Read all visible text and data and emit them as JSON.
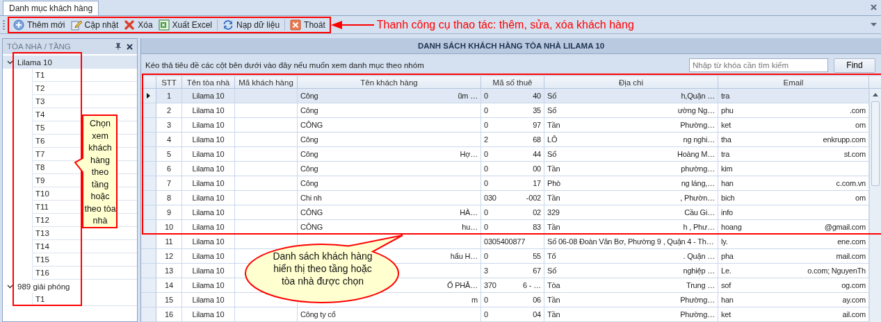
{
  "tabs": [
    {
      "label": "Danh mục khách hàng",
      "selected": true
    }
  ],
  "toolbar": {
    "buttons": [
      {
        "label": "Thêm mới",
        "kind": "add",
        "separator_before": false
      },
      {
        "label": "Cập nhật",
        "kind": "edit",
        "separator_before": false
      },
      {
        "label": "Xóa",
        "kind": "delete",
        "separator_before": false
      },
      {
        "label": "Xuất Excel",
        "kind": "excel",
        "separator_before": false
      },
      {
        "label": "Nạp dữ liệu",
        "kind": "refresh",
        "separator_before": true
      },
      {
        "label": "Thoát",
        "kind": "exit",
        "separator_before": true
      }
    ]
  },
  "tree": {
    "title": "TÒA NHÀ / TẦNG",
    "nodes": [
      {
        "label": "Lilama 10",
        "expanded": true,
        "selected": true,
        "children": [
          {
            "label": "T1"
          },
          {
            "label": "T2"
          },
          {
            "label": "T3"
          },
          {
            "label": "T4"
          },
          {
            "label": "T5"
          },
          {
            "label": "T6"
          },
          {
            "label": "T7"
          },
          {
            "label": "T8"
          },
          {
            "label": "T9"
          },
          {
            "label": "T10"
          },
          {
            "label": "T11"
          },
          {
            "label": "T12"
          },
          {
            "label": "T13"
          },
          {
            "label": "T14"
          },
          {
            "label": "T15"
          },
          {
            "label": "T16"
          }
        ]
      },
      {
        "label": "989 giải phóng",
        "expanded": true,
        "selected": false,
        "children": [
          {
            "label": "T1"
          }
        ]
      }
    ]
  },
  "grid": {
    "title": "DANH SÁCH KHÁCH HÀNG TÒA NHÀ LILAMA 10",
    "group_hint": "Kéo thả tiêu đề các cột bên dưới vào đây nếu muốn xem danh mục theo nhóm",
    "search": {
      "placeholder": "Nhập từ khóa cần tìm kiếm"
    },
    "find_button": "Find",
    "columns": [
      {
        "label": "STT"
      },
      {
        "label": "Tên tòa nhà"
      },
      {
        "label": "Mã khách hàng"
      },
      {
        "label": "Tên khách hàng"
      },
      {
        "label": "Mã số thuê"
      },
      {
        "label": "Địa chi"
      },
      {
        "label": "Email"
      }
    ],
    "rows": [
      {
        "selected": true,
        "stt": "1",
        "building": "Lilama 10",
        "name": {
          "start": "Công",
          "end": "ũm …"
        },
        "tax": {
          "start": "0",
          "end": "40"
        },
        "address": {
          "start": "Số",
          "end": "h,Quận …"
        },
        "email": {
          "start": "tra"
        }
      },
      {
        "selected": false,
        "stt": "2",
        "building": "Lilama 10",
        "name": {
          "start": "Công"
        },
        "tax": {
          "start": "0",
          "end": "35"
        },
        "address": {
          "start": "Số",
          "end": "ường Ng…"
        },
        "email": {
          "start": "phu",
          "end": ".com"
        }
      },
      {
        "selected": false,
        "stt": "3",
        "building": "Lilama 10",
        "name": {
          "start": "CÔNG"
        },
        "tax": {
          "start": "0",
          "end": "97"
        },
        "address": {
          "start": "Tần",
          "end": "Phường…"
        },
        "email": {
          "start": "ket",
          "end": "om"
        }
      },
      {
        "selected": false,
        "stt": "4",
        "building": "Lilama 10",
        "name": {
          "start": "Công"
        },
        "tax": {
          "start": "2",
          "end": "68"
        },
        "address": {
          "start": "LÔ",
          "end": "ng nghi…"
        },
        "email": {
          "start": "tha",
          "end": "enkrupp.com"
        }
      },
      {
        "selected": false,
        "stt": "5",
        "building": "Lilama 10",
        "name": {
          "start": "Công",
          "end": "Hợ…"
        },
        "tax": {
          "start": "0",
          "end": "44"
        },
        "address": {
          "start": "Số",
          "end": "Hoàng M…"
        },
        "email": {
          "start": "tra",
          "end": "st.com"
        }
      },
      {
        "selected": false,
        "stt": "6",
        "building": "Lilama 10",
        "name": {
          "start": "Công"
        },
        "tax": {
          "start": "0",
          "end": "00"
        },
        "address": {
          "start": "Tần",
          "end": "phường…"
        },
        "email": {
          "start": "kim"
        }
      },
      {
        "selected": false,
        "stt": "7",
        "building": "Lilama 10",
        "name": {
          "start": "Công"
        },
        "tax": {
          "start": "0",
          "end": "17"
        },
        "address": {
          "start": "Phò",
          "end": "ng láng,…"
        },
        "email": {
          "start": "han",
          "end": "c.com.vn"
        }
      },
      {
        "selected": false,
        "stt": "8",
        "building": "Lilama 10",
        "name": {
          "start": "Chi nh"
        },
        "tax": {
          "start": "030",
          "end": "-002"
        },
        "address": {
          "start": "Tần",
          "end": ", Phườn…"
        },
        "email": {
          "start": "bich",
          "end": "om"
        }
      },
      {
        "selected": false,
        "stt": "9",
        "building": "Lilama 10",
        "name": {
          "start": "CÔNG",
          "end": "HÀ…"
        },
        "tax": {
          "start": "0",
          "end": "02"
        },
        "address": {
          "start": "329",
          "end": "Cầu Gi…"
        },
        "email": {
          "start": "info"
        }
      },
      {
        "selected": false,
        "stt": "10",
        "building": "Lilama 10",
        "name": {
          "start": "CÔNG",
          "end": "hu…"
        },
        "tax": {
          "start": "0",
          "end": "83"
        },
        "address": {
          "start": "Tần",
          "end": "h , Phư…"
        },
        "email": {
          "start": "hoang",
          "end": "@gmail.com"
        }
      },
      {
        "selected": false,
        "stt": "11",
        "building": "Lilama 10",
        "tax": {
          "start": "0305400877"
        },
        "address": {
          "start": "Số 06-08 Đoàn Văn Bơ, Phường 9 , Quận 4 - Th…"
        },
        "email": {
          "start": "ly.",
          "end": "ene.com"
        }
      },
      {
        "selected": false,
        "stt": "12",
        "building": "Lilama 10",
        "name": {
          "end": "hẩu H…"
        },
        "tax": {
          "start": "0",
          "end": "55"
        },
        "address": {
          "start": "Tổ",
          "end": ". Quận …"
        },
        "email": {
          "start": "pha",
          "end": "mail.com"
        }
      },
      {
        "selected": false,
        "stt": "13",
        "building": "Lilama 10",
        "tax": {
          "start": "3",
          "end": "67"
        },
        "address": {
          "start": "Số",
          "end": "nghiệp …"
        },
        "email": {
          "start": "Le.",
          "end": "o.com; NguyenTh"
        }
      },
      {
        "selected": false,
        "stt": "14",
        "building": "Lilama 10",
        "name": {
          "end": "Ố PHẪ…"
        },
        "tax": {
          "start": "370",
          "end": "6 - …"
        },
        "address": {
          "start": "Tòa",
          "end": "Trung …"
        },
        "email": {
          "start": "sof",
          "end": "og.com"
        }
      },
      {
        "selected": false,
        "stt": "15",
        "building": "Lilama 10",
        "name": {
          "end": "m"
        },
        "tax": {
          "start": "0",
          "end": "06"
        },
        "address": {
          "start": "Tần",
          "end": "Phường…"
        },
        "email": {
          "start": "han",
          "end": "ay.com"
        }
      },
      {
        "selected": false,
        "stt": "16",
        "building": "Lilama 10",
        "name": {
          "start": "Công ty cổ"
        },
        "tax": {
          "start": "0",
          "end": "04"
        },
        "address": {
          "start": "Tần",
          "end": "Phường…"
        },
        "email": {
          "start": "ket",
          "end": "ail.com"
        }
      }
    ]
  },
  "annotations": {
    "toolbar_note": "Thanh công cụ thao tác: thêm, sửa, xóa khách hàng",
    "tree_note": "Chọn xem khách hàng theo tầng hoặc theo tòa nhà",
    "grid_note": "Danh sách khách hàng hiển thị theo tầng hoặc tòa nhà được chọn"
  }
}
